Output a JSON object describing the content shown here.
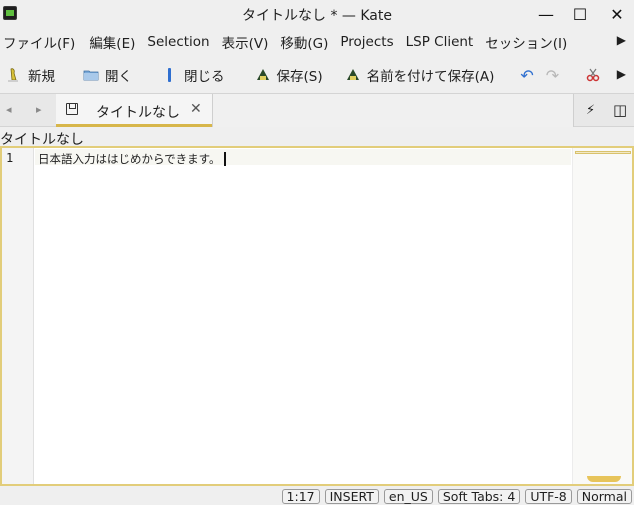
{
  "window": {
    "title": "タイトルなし * — Kate",
    "minimize_glyph": "—",
    "maximize_glyph": "☐",
    "close_glyph": "✕"
  },
  "menu": {
    "items": [
      "ファイル(F)",
      "編集(E)",
      "Selection",
      "表示(V)",
      "移動(G)",
      "Projects",
      "LSP Client",
      "セッション(I)"
    ],
    "more_glyph": "▶"
  },
  "toolbar": {
    "new_label": "新規",
    "open_label": "開く",
    "close_label": "閉じる",
    "save_label": "保存(S)",
    "save_as_label": "名前を付けて保存(A)",
    "undo_glyph": "↶",
    "redo_glyph": "↷",
    "more_glyph": "▶"
  },
  "tabs": {
    "prev_glyph": "◂",
    "next_glyph": "▸",
    "active_label": "タイトルなし",
    "close_glyph": "✕",
    "quick_open_glyph": "⚡",
    "split_glyph": "◫"
  },
  "document": {
    "title": "タイトルなし",
    "lines": [
      {
        "number": "1",
        "text": "日本語入力ははじめからできます。"
      }
    ]
  },
  "status": {
    "position": "1:17",
    "mode": "INSERT",
    "language": "en_US",
    "indent": "Soft Tabs: 4",
    "encoding": "UTF-8",
    "input_mode": "Normal"
  },
  "colors": {
    "accent": "#d7b64a",
    "editor_border": "#e2cd7a",
    "undo_blue": "#2f6fd0",
    "cut_red": "#cc3333"
  }
}
